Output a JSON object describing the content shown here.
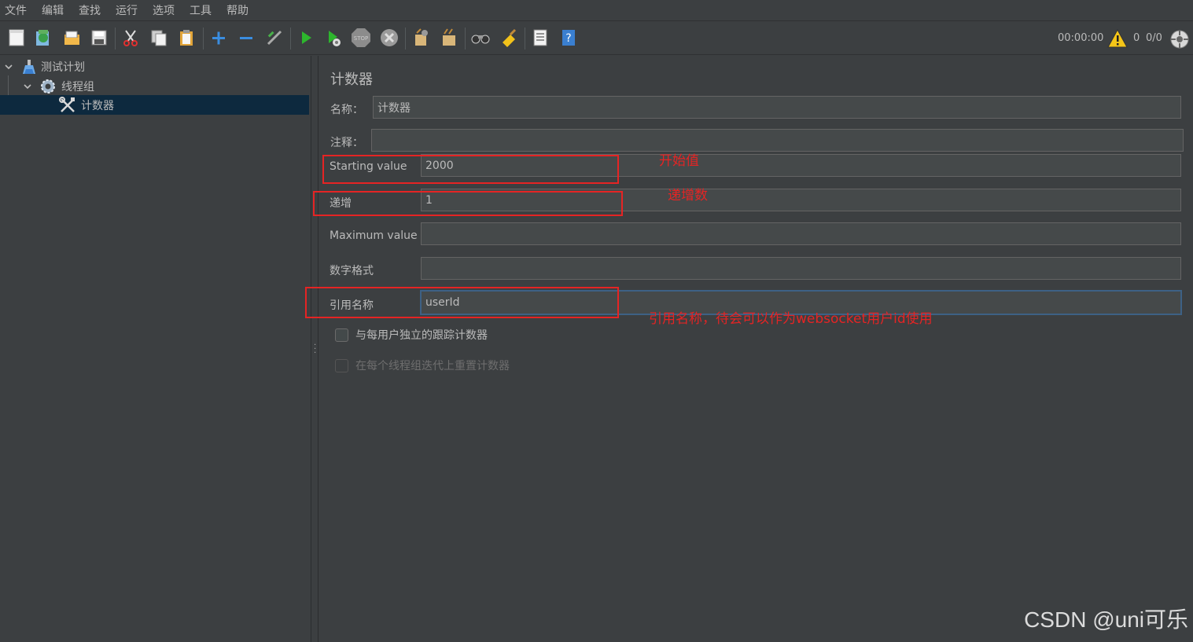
{
  "menu": [
    "文件",
    "编辑",
    "查找",
    "运行",
    "选项",
    "工具",
    "帮助"
  ],
  "toolbar": {
    "icons": [
      "new-icon",
      "templates-icon",
      "open-icon",
      "save-icon",
      "cut-icon",
      "copy-icon",
      "paste-icon",
      "expand-icon",
      "collapse-icon",
      "toggle-icon",
      "start-icon",
      "start-no-pause-icon",
      "stop-icon",
      "shutdown-icon",
      "clear-icon",
      "clear-all-icon",
      "search-icon",
      "reset-search-icon",
      "function-helper-icon",
      "help-icon"
    ],
    "elapsed_time": "00:00:00",
    "error_count": "0",
    "threads": "0/0"
  },
  "tree": {
    "items": [
      {
        "label": "测试计划",
        "icon": "test-plan-icon"
      },
      {
        "label": "线程组",
        "icon": "thread-group-icon"
      },
      {
        "label": "计数器",
        "icon": "counter-tools-icon"
      }
    ]
  },
  "panel": {
    "title": "计数器",
    "name_label": "名称：",
    "name_value": "计数器",
    "comment_label": "注释：",
    "comment_value": "",
    "starting_label": "Starting value",
    "starting_value": "2000",
    "increment_label": "递增",
    "increment_value": "1",
    "maximum_label": "Maximum value",
    "maximum_value": "",
    "format_label": "数字格式",
    "format_value": "",
    "ref_label": "引用名称",
    "ref_value": "userId",
    "check_per_user": "与每用户独立的跟踪计数器",
    "check_reset": "在每个线程组迭代上重置计数器"
  },
  "annotations": {
    "starting_note": "开始值",
    "increment_note": "递增数",
    "ref_note": "引用名称，待会可以作为websocket用户id使用",
    "color": "#e52424"
  },
  "watermark": "CSDN @uni可乐"
}
